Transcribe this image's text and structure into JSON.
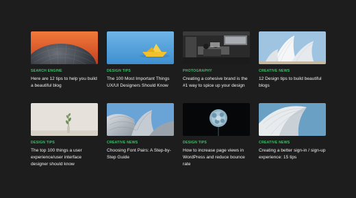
{
  "colors": {
    "background": "#1d1d1d",
    "category": "#3fc06a",
    "title": "#f2f2f2"
  },
  "cards": [
    {
      "category": "SEARCH ENGINE",
      "title": "Here are 12 tips to help you build a beautiful blog",
      "image": "dome-image"
    },
    {
      "category": "DESIGN TIPS",
      "title": "The 100 Most Important Things UX/UI Designers Should Know",
      "image": "paper-boat-image"
    },
    {
      "category": "PHOTOGRAPHY",
      "title": "Creating a cohesive brand is the #1 way to spice up your design",
      "image": "workspace-image"
    },
    {
      "category": "CREATIVE NEWS",
      "title": "12 Design tips to build beautiful blogs",
      "image": "opera-house-image"
    },
    {
      "category": "DESIGN TIPS",
      "title": "The top 100 things a user experience/user interface designer should know",
      "image": "plant-vase-image"
    },
    {
      "category": "CREATIVE NEWS",
      "title": "Choosing Font Pairs: A Step-by-Step Guide",
      "image": "curved-building-image"
    },
    {
      "category": "DESIGN TIPS",
      "title": "How to increase page views in WordPress and reduce bounce rate",
      "image": "flower-image"
    },
    {
      "category": "CREATIVE NEWS",
      "title": "Creating a better sign-in / sign-up experience: 15 tips",
      "image": "architecture-image"
    }
  ]
}
